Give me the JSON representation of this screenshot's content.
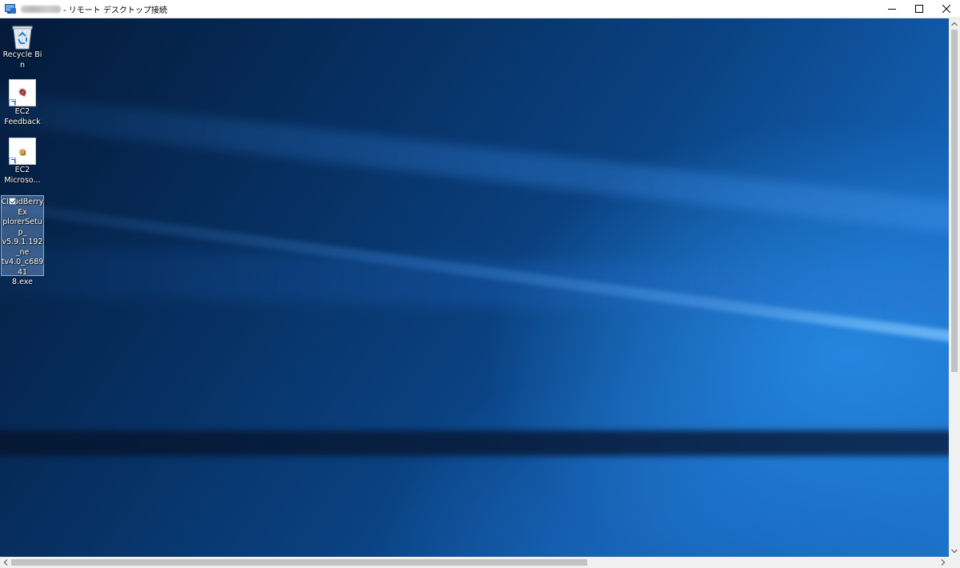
{
  "window": {
    "title": "- リモート デスクトップ接続",
    "host_redacted": true,
    "controls": {
      "minimize": "minimize",
      "maximize": "maximize",
      "close": "close"
    }
  },
  "desktop": {
    "icons": [
      {
        "label": "Recycle Bin",
        "icon": "recycle-bin-icon",
        "selected": false
      },
      {
        "label": "EC2 Feedback",
        "icon": "ec2-feedback-icon",
        "mark": "Q",
        "mark_color": "#d0202a",
        "shortcut": true,
        "selected": false
      },
      {
        "label": "EC2 Microso...",
        "icon": "ec2-microsoft-icon",
        "mark": "■",
        "mark_color": "#f0a020",
        "shortcut": true,
        "selected": false
      },
      {
        "label": "CloudBerryExplorerSetup_v5.9.1.192_netv4.0_c689418.exe",
        "icon": "cloudberry-installer-icon",
        "shortcut": false,
        "selected": true,
        "checked": true
      }
    ]
  },
  "scrollbars": {
    "vertical_position": 0.0,
    "horizontal_position": 0.0
  },
  "colors": {
    "desktop_dark": "#041a39",
    "desktop_light": "#1a6fc4",
    "selection": "#78a0d2"
  }
}
